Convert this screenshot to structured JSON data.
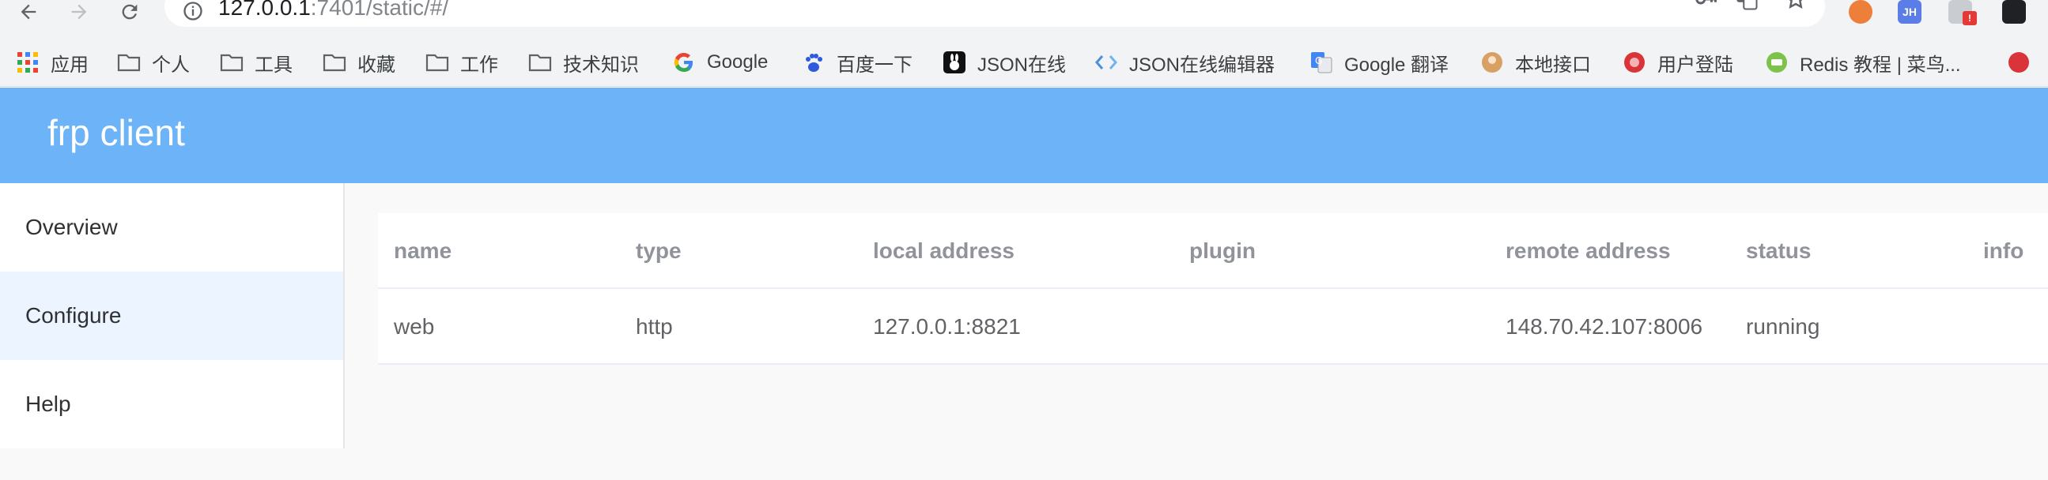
{
  "browser": {
    "url_host": "127.0.0.1",
    "url_rest": ":7401/static/#/",
    "extension_badge": "JH",
    "alert_badge": "!",
    "bookmarks": [
      {
        "label": "应用",
        "icon": "apps-grid-icon"
      },
      {
        "label": "个人",
        "icon": "folder-icon"
      },
      {
        "label": "工具",
        "icon": "folder-icon"
      },
      {
        "label": "收藏",
        "icon": "folder-icon"
      },
      {
        "label": "工作",
        "icon": "folder-icon"
      },
      {
        "label": "技术知识",
        "icon": "folder-icon"
      },
      {
        "label": "Google",
        "icon": "google-icon"
      },
      {
        "label": "百度一下",
        "icon": "baidu-paw-icon"
      },
      {
        "label": "JSON在线",
        "icon": "rabbit-icon"
      },
      {
        "label": "JSON在线编辑器",
        "icon": "code-brackets-icon"
      },
      {
        "label": "Google 翻译",
        "icon": "google-translate-icon"
      },
      {
        "label": "本地接口",
        "icon": "circle-avatar-icon"
      },
      {
        "label": "用户登陆",
        "icon": "red-circle-icon"
      },
      {
        "label": "Redis 教程 | 菜鸟...",
        "icon": "runoob-icon"
      }
    ]
  },
  "app": {
    "title": "frp client",
    "menu": [
      {
        "label": "Overview",
        "active": false
      },
      {
        "label": "Configure",
        "active": true
      },
      {
        "label": "Help",
        "active": false
      }
    ],
    "table": {
      "columns": [
        "name",
        "type",
        "local address",
        "plugin",
        "remote address",
        "status",
        "info"
      ],
      "rows": [
        [
          "web",
          "http",
          "127.0.0.1:8821",
          "",
          "148.70.42.107:8006",
          "running",
          ""
        ]
      ]
    }
  },
  "colors": {
    "header": "#6cb3f7",
    "active_menu": "#ecf5ff",
    "chrome": "#f1f3f4"
  }
}
